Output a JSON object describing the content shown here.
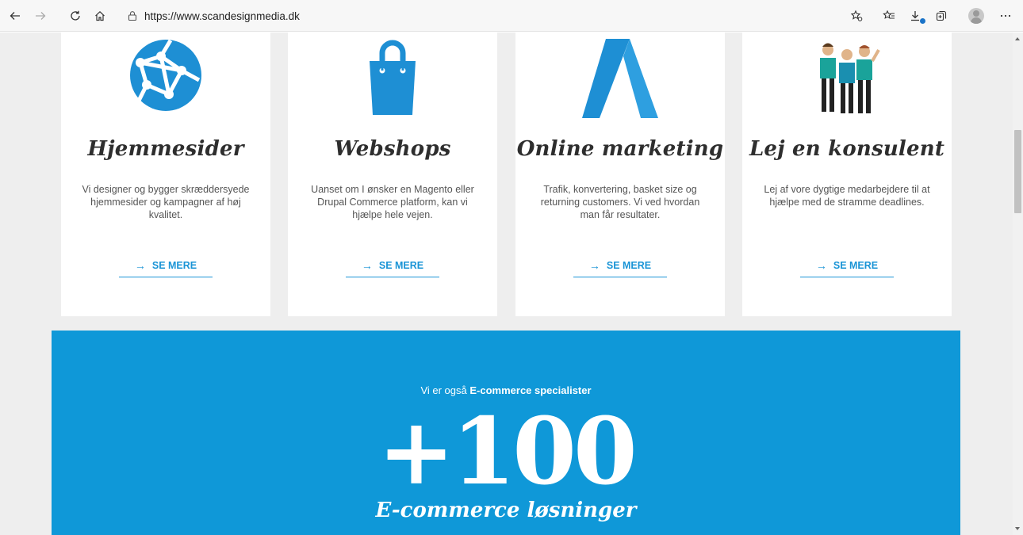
{
  "browser": {
    "url": "https://www.scandesignmedia.dk"
  },
  "cards": [
    {
      "title": "Hjemmesider",
      "text": "Vi designer og bygger skræddersyede hjemmesider og kampagner af høj kvalitet.",
      "link": "SE MERE",
      "icon": "globe-network-icon"
    },
    {
      "title": "Webshops",
      "text": "Uanset om I ønsker en Magento eller Drupal Commerce platform, kan vi hjælpe hele vejen.",
      "link": "SE MERE",
      "icon": "shopping-bag-icon"
    },
    {
      "title": "Online marketing",
      "text": "Trafik, konvertering, basket size og returning customers. Vi ved hvordan man får resultater.",
      "link": "SE MERE",
      "icon": "adwords-logo-icon"
    },
    {
      "title": "Lej en konsulent",
      "text": "Lej af vore dygtige medarbejdere til at hjælpe med de stramme deadlines.",
      "link": "SE MERE",
      "icon": "consultants-illustration-icon"
    }
  ],
  "banner": {
    "intro_prefix": "Vi er også",
    "intro_bold": "E-commerce specialister",
    "big_number": "+100",
    "subtitle": "E-commerce løsninger",
    "background": "#0f98d8"
  },
  "colors": {
    "accent": "#1a94d6",
    "page_bg": "#eeeeee"
  }
}
